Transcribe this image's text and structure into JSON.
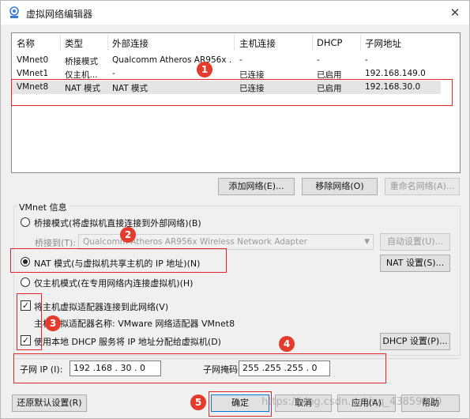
{
  "window": {
    "title": "虚拟网络编辑器",
    "close": "✕"
  },
  "table": {
    "columns": [
      "名称",
      "类型",
      "外部连接",
      "主机连接",
      "DHCP",
      "子网地址"
    ],
    "rows": [
      {
        "name": "VMnet0",
        "type": "桥接模式",
        "external": "Qualcomm Atheros AR956x ...",
        "host": "-",
        "dhcp": "-",
        "subnet": "-"
      },
      {
        "name": "VMnet1",
        "type": "仅主机...",
        "external": "-",
        "host": "已连接",
        "dhcp": "已启用",
        "subnet": "192.168.149.0"
      },
      {
        "name": "VMnet8",
        "type": "NAT 模式",
        "external": "NAT 模式",
        "host": "已连接",
        "dhcp": "已启用",
        "subnet": "192.168.30.0"
      }
    ]
  },
  "list_buttons": {
    "add": "添加网络(E)...",
    "remove": "移除网络(O)",
    "rename": "重命名网络(A)..."
  },
  "vmnet_info": {
    "label": "VMnet 信息",
    "bridged": "桥接模式(将虚拟机直接连接到外部网络)(B)",
    "bridged_to_label": "桥接到(T):",
    "bridged_to_value": "Qualcomm Atheros AR956x Wireless Network Adapter",
    "auto_settings": "自动设置(U)...",
    "nat": "NAT 模式(与虚拟机共享主机的 IP 地址)(N)",
    "nat_settings": "NAT 设置(S)...",
    "host_only": "仅主机模式(在专用网络内连接虚拟机)(H)",
    "connect_adapter": "将主机虚拟适配器连接到此网络(V)",
    "adapter_name": "主机虚拟适配器名称: VMware 网络适配器 VMnet8",
    "use_dhcp": "使用本地 DHCP 服务将 IP 地址分配给虚拟机(D)",
    "dhcp_settings": "DHCP 设置(P)...",
    "subnet_ip_label": "子网 IP (I):",
    "subnet_ip": "192 .168 . 30 . 0",
    "subnet_mask_label": "子网掩码(M):",
    "subnet_mask": "255 .255 .255 . 0"
  },
  "bottom_buttons": {
    "restore": "还原默认设置(R)",
    "ok": "确定",
    "cancel": "取消",
    "apply": "应用(A)",
    "help": "帮助"
  },
  "annotations": [
    "1",
    "2",
    "3",
    "4",
    "5"
  ],
  "watermark": "https://blog.csdn.net/qq_43859920",
  "colors": {
    "annotation": "#e0262b",
    "badge": "#e53b2c",
    "selected_row": "#e5e5e5",
    "default_button_border": "#0078d7"
  }
}
